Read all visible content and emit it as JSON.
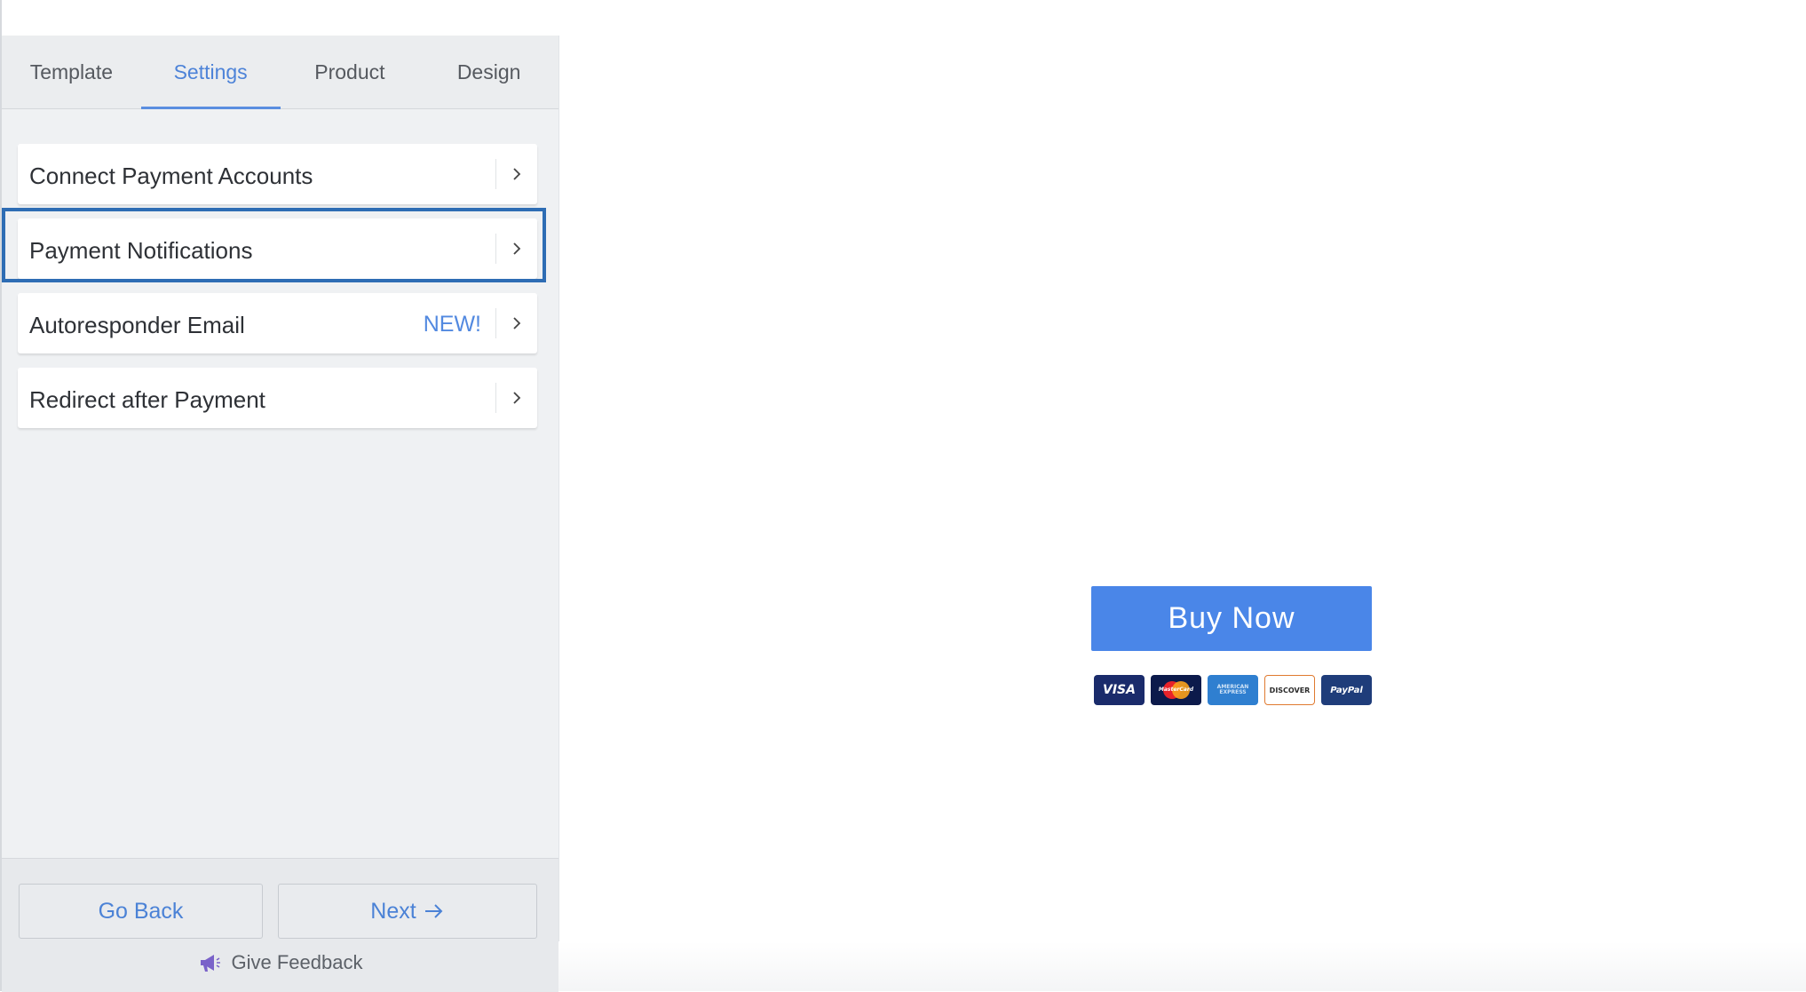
{
  "tabs": [
    {
      "label": "Template",
      "active": false
    },
    {
      "label": "Settings",
      "active": true
    },
    {
      "label": "Product",
      "active": false
    },
    {
      "label": "Design",
      "active": false
    }
  ],
  "menu": [
    {
      "label": "Connect Payment Accounts",
      "badge": ""
    },
    {
      "label": "Payment Notifications",
      "badge": ""
    },
    {
      "label": "Autoresponder Email",
      "badge": "NEW!"
    },
    {
      "label": "Redirect after Payment",
      "badge": ""
    }
  ],
  "footer": {
    "back_label": "Go Back",
    "next_label": "Next",
    "feedback_label": "Give Feedback"
  },
  "preview": {
    "buy_now_label": "Buy Now",
    "cards": [
      {
        "name": "visa-card-icon",
        "text": "VISA"
      },
      {
        "name": "mastercard-icon",
        "text": "MasterCard"
      },
      {
        "name": "amex-card-icon",
        "text": "AMERICAN EXPRESS"
      },
      {
        "name": "discover-card-icon",
        "text": "DISCOVER"
      },
      {
        "name": "paypal-icon",
        "text": "PayPal"
      }
    ]
  },
  "colors": {
    "accent": "#4d83d8",
    "buy_button": "#4a86e8",
    "highlight_border": "#2e6db4"
  }
}
